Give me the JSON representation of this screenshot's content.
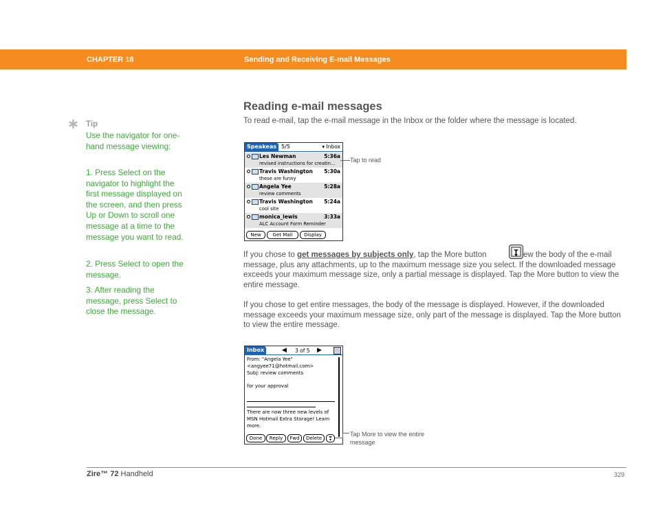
{
  "header": {
    "chapter": "CHAPTER 18",
    "title": "Sending and Receiving E-mail Messages",
    "bar_color": "#f68b1f"
  },
  "tip": {
    "icon": "asterisk-icon",
    "label": "Tip",
    "paragraphs": [
      "Use the navigator for one-hand message viewing:",
      "1. Press Select on the navigator to highlight the first message displayed on the screen, and then press Up or Down to scroll one message at a time to the message you want to read.",
      "2. Press Select to open the message.",
      "3. After reading the message, press Select to close the message."
    ],
    "color": "#3aa935"
  },
  "main": {
    "section_title": "Reading e-mail messages",
    "intro": "To read e-mail, tap the e-mail message in the Inbox or the folder where the message is located.",
    "para1_before": "If you chose to ",
    "para1_link": "get messages by subjects only",
    "para1_mid": ", tap the More button ",
    "para1_after": " to view the body of the e-mail message, plus any attachments, up to the maximum message size you select. If the downloaded message exceeds your maximum message size, only a partial message is displayed. Tap the More button to view the entire message.",
    "para2": "If you chose to get entire messages, the body of the message is displayed. However, if the downloaded message exceeds your maximum message size, only part of the message is displayed. Tap the More button to view the entire message."
  },
  "inbox_screen": {
    "tab": "Speakeas",
    "count": "5/5",
    "folder": "▾ Inbox",
    "messages": [
      {
        "from": "Les Newman",
        "time": "5:36a",
        "subject": "revised instructions for creatin..."
      },
      {
        "from": "Travis Washington",
        "time": "5:30a",
        "subject": "these are funny"
      },
      {
        "from": "Angela Yee",
        "time": "5:28a",
        "subject": "review comments"
      },
      {
        "from": "Travis Washington",
        "time": "5:24a",
        "subject": "cool site"
      },
      {
        "from": "monica_lewis",
        "time": "3:33a",
        "subject": "ALC Account Form Reminder"
      }
    ],
    "buttons": [
      "New",
      "Get Mail",
      "Display"
    ],
    "callout": "Tap to read"
  },
  "message_screen": {
    "tab": "Inbox",
    "position": "3 of 5",
    "from_line": "From: \"Angela Yee\"",
    "email_line": "<angyee71@hotmail.com>",
    "subject_line": " Subj:  review comments",
    "body_line": "for your approval",
    "footer_lines": [
      "There are now three new levels of",
      "MSN Hotmail Extra Storage!  Learn",
      "more."
    ],
    "buttons": [
      "Done",
      "Reply",
      "Fwd",
      "Delete"
    ],
    "callout": "Tap More to view the entire message"
  },
  "footer": {
    "product_bold": "Zire™ 72",
    "product_rest": " Handheld",
    "page": "329"
  }
}
